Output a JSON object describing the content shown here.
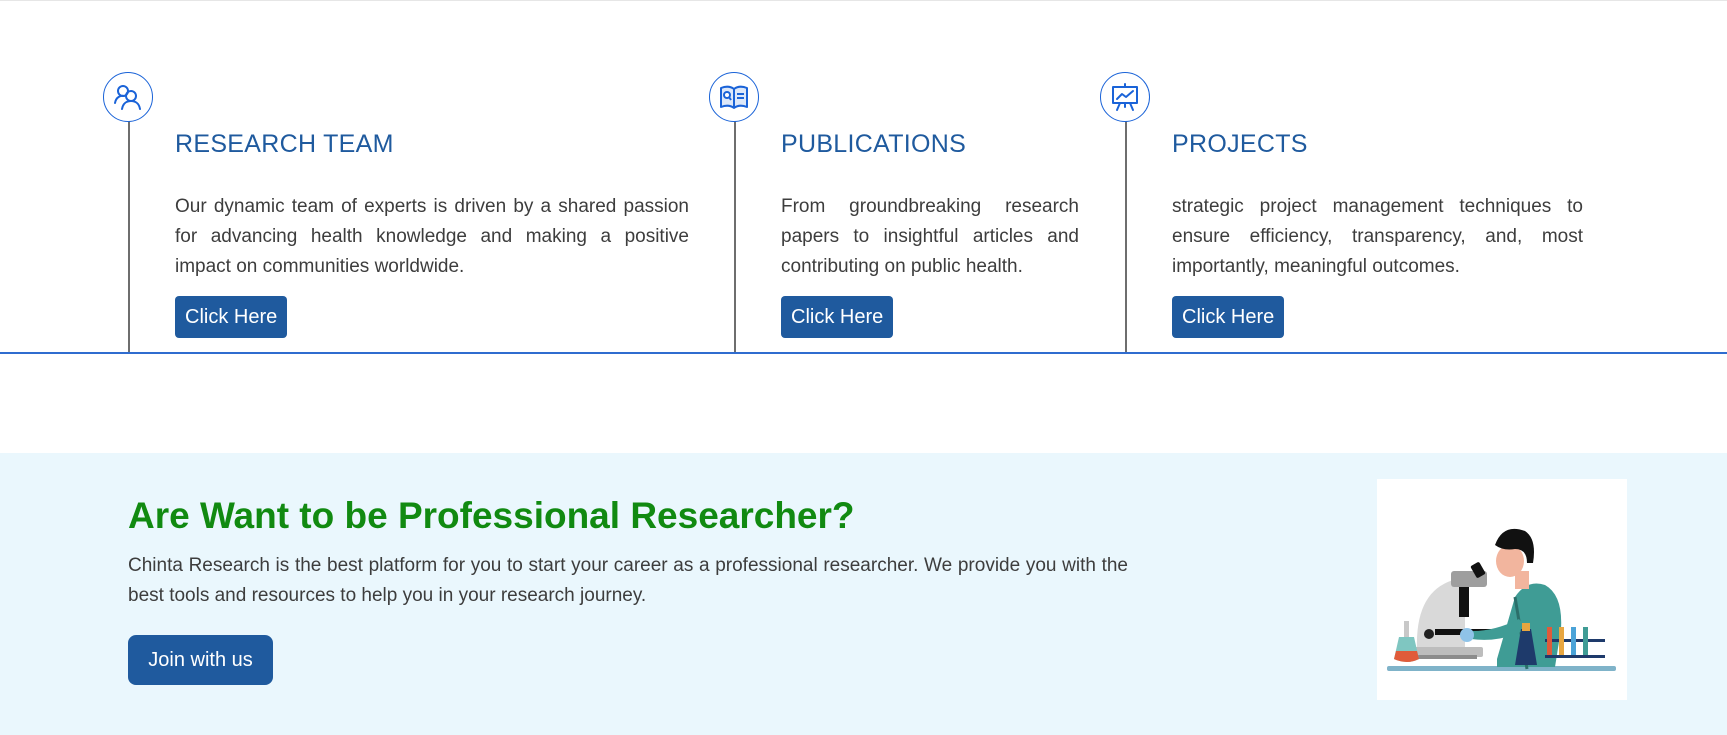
{
  "features": [
    {
      "icon": "team-icon",
      "title": "RESEARCH TEAM",
      "description": "Our dynamic team of experts is driven by a shared passion for advancing health knowledge and making a positive impact on communities worldwide.",
      "button_label": "Click Here"
    },
    {
      "icon": "book-icon",
      "title": "PUBLICATIONS",
      "description": "From groundbreaking research papers to insightful articles and contributing on public health.",
      "button_label": "Click Here"
    },
    {
      "icon": "presentation-chart-icon",
      "title": "PROJECTS",
      "description": "strategic project management techniques to ensure efficiency, transparency, and, most importantly, meaningful outcomes.",
      "button_label": "Click Here"
    }
  ],
  "cta": {
    "heading": "Are Want to be Professional Researcher?",
    "text": "Chinta Research is the best platform for you to start your career as a professional researcher. We provide you with the best tools and resources to help you in your research journey.",
    "button_label": "Join with us",
    "illustration": "scientist-microscope-illustration"
  },
  "colors": {
    "accent_blue": "#1f5a9e",
    "icon_blue": "#1a63d8",
    "heading_green": "#118a11",
    "cta_background": "#eaf7fd",
    "divider_blue": "#2f6ccf"
  }
}
